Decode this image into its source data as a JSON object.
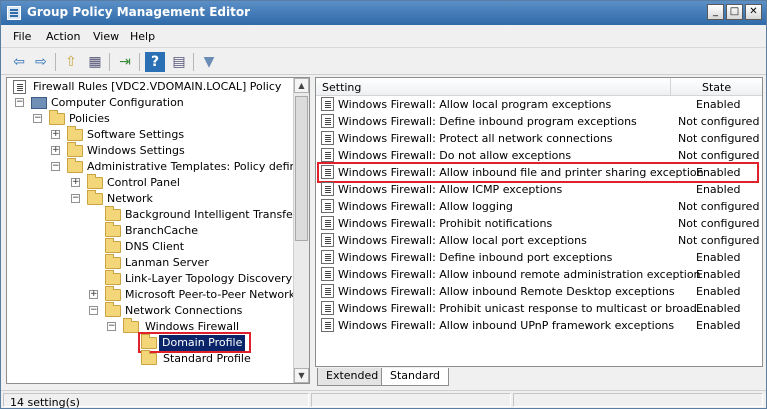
{
  "window": {
    "title": "Group Policy Management Editor"
  },
  "title_buttons": {
    "minimize": "_",
    "maximize": "□",
    "close": "✕"
  },
  "menu": [
    "File",
    "Action",
    "View",
    "Help"
  ],
  "toolbar": {
    "icons": [
      "back-icon",
      "forward-icon",
      "up-folder-icon",
      "show-hide-tree-icon",
      "export-icon",
      "help-icon",
      "properties-icon",
      "filter-icon"
    ],
    "glyphs": {
      "back": "⇦",
      "forward": "⇨",
      "up": "⇧",
      "tree": "▦",
      "export": "⇥",
      "help": "?",
      "properties": "▤",
      "filter": "▼"
    }
  },
  "tree": [
    {
      "label": "Firewall Rules [VDC2.VDOMAIN.LOCAL] Policy",
      "icon": "doc",
      "expander": ""
    },
    {
      "label": "Computer Configuration",
      "icon": "computer",
      "expander": "−"
    },
    {
      "label": "Policies",
      "icon": "folder",
      "expander": "−"
    },
    {
      "label": "Software Settings",
      "icon": "folder",
      "expander": "+"
    },
    {
      "label": "Windows Settings",
      "icon": "folder",
      "expander": "+"
    },
    {
      "label": "Administrative Templates: Policy definitions",
      "icon": "folder",
      "expander": "−"
    },
    {
      "label": "Control Panel",
      "icon": "folder",
      "expander": "+"
    },
    {
      "label": "Network",
      "icon": "folder",
      "expander": "−"
    },
    {
      "label": "Background Intelligent Transfer Ser",
      "icon": "folder",
      "expander": ""
    },
    {
      "label": "BranchCache",
      "icon": "folder",
      "expander": ""
    },
    {
      "label": "DNS Client",
      "icon": "folder",
      "expander": ""
    },
    {
      "label": "Lanman Server",
      "icon": "folder",
      "expander": ""
    },
    {
      "label": "Link-Layer Topology Discovery",
      "icon": "folder",
      "expander": ""
    },
    {
      "label": "Microsoft Peer-to-Peer Networking",
      "icon": "folder",
      "expander": "+"
    },
    {
      "label": "Network Connections",
      "icon": "folder",
      "expander": "−"
    },
    {
      "label": "Windows Firewall",
      "icon": "folder",
      "expander": "−"
    },
    {
      "label": "Domain Profile",
      "icon": "folder",
      "expander": "",
      "selected": true
    },
    {
      "label": "Standard Profile",
      "icon": "folder",
      "expander": ""
    }
  ],
  "list": {
    "columns": [
      "Setting",
      "State"
    ],
    "rows": [
      {
        "setting": "Windows Firewall: Allow local program exceptions",
        "state": "Enabled"
      },
      {
        "setting": "Windows Firewall: Define inbound program exceptions",
        "state": "Not configured"
      },
      {
        "setting": "Windows Firewall: Protect all network connections",
        "state": "Not configured"
      },
      {
        "setting": "Windows Firewall: Do not allow exceptions",
        "state": "Not configured"
      },
      {
        "setting": "Windows Firewall: Allow inbound file and printer sharing exception",
        "state": "Enabled",
        "highlighted": true
      },
      {
        "setting": "Windows Firewall: Allow ICMP exceptions",
        "state": "Enabled"
      },
      {
        "setting": "Windows Firewall: Allow logging",
        "state": "Not configured"
      },
      {
        "setting": "Windows Firewall: Prohibit notifications",
        "state": "Not configured"
      },
      {
        "setting": "Windows Firewall: Allow local port exceptions",
        "state": "Not configured"
      },
      {
        "setting": "Windows Firewall: Define inbound port exceptions",
        "state": "Enabled"
      },
      {
        "setting": "Windows Firewall: Allow inbound remote administration exception",
        "state": "Enabled"
      },
      {
        "setting": "Windows Firewall: Allow inbound Remote Desktop exceptions",
        "state": "Enabled"
      },
      {
        "setting": "Windows Firewall: Prohibit unicast response to multicast or broad...",
        "state": "Enabled"
      },
      {
        "setting": "Windows Firewall: Allow inbound UPnP framework exceptions",
        "state": "Enabled"
      }
    ]
  },
  "tabs": [
    "Extended",
    "Standard"
  ],
  "active_tab": "Standard",
  "status": "14 setting(s)",
  "colors": {
    "highlight_box": "#e0202a",
    "selection": "#0a246a",
    "title_bar": "#2f6aa9"
  }
}
